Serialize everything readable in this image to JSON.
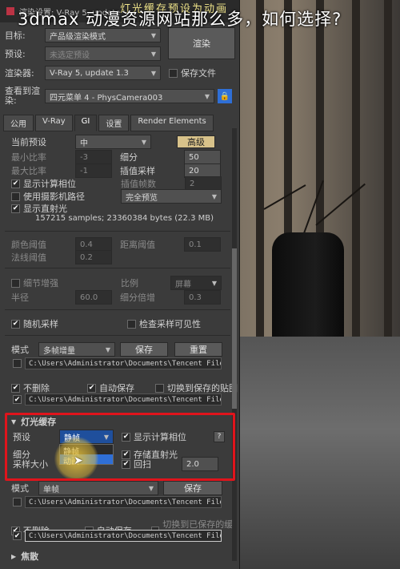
{
  "overlay_title": "3dmax 动漫资源网站那么多，如何选择?",
  "banner_text": "灯光缓存预设为动画",
  "titlebar": {
    "text": "渲染设置: V-Ray 5, update"
  },
  "top": {
    "target_label": "目标:",
    "target_value": "产品级渲染模式",
    "preset_label": "预设:",
    "preset_value": "未选定预设",
    "renderer_label": "渲染器:",
    "renderer_value": "V-Ray 5, update 1.3",
    "save_file_label": "保存文件",
    "render_button": "渲染",
    "view_label": "查看到渲染:",
    "view_value": "四元菜单 4 - PhysCamera003"
  },
  "tabs": [
    "公用",
    "V-Ray",
    "GI",
    "设置",
    "Render Elements"
  ],
  "gi": {
    "current_preset_label": "当前预设",
    "current_preset_value": "中",
    "advanced_button": "高级",
    "min_rate_label": "最小比率",
    "min_rate_value": "-3",
    "max_rate_label": "最大比率",
    "max_rate_value": "-1",
    "subdivs_label": "细分",
    "subdivs_value": "50",
    "interp_samples_label": "插值采样",
    "interp_samples_value": "20",
    "interp_frames_label": "插值帧数",
    "interp_frames_value": "2",
    "show_calc_phase": "显示计算相位",
    "use_camera_path": "使用摄影机路径",
    "show_direct_light": "显示直射光",
    "full_preview": "完全预览",
    "samples_info": "157215 samples; 23360384 bytes (22.3 MB)",
    "color_thresh_label": "颜色阈值",
    "color_thresh_value": "0.4",
    "dist_thresh_label": "距离阈值",
    "dist_thresh_value": "0.1",
    "normal_thresh_label": "法线阈值",
    "normal_thresh_value": "0.2",
    "detail_enh": "细节增强",
    "scale_label": "比例",
    "scale_value": "屏幕",
    "radius_label": "半径",
    "radius_value": "60.0",
    "subdiv_mult_label": "细分倍增",
    "subdiv_mult_value": "0.3",
    "random_samples": "随机采样",
    "check_visibility": "检查采样可见性",
    "mode_label": "模式",
    "mode_value": "多帧增量",
    "save_button": "保存",
    "reset_button": "重置",
    "path1": "C:\\Users\\Administrator\\Documents\\Tencent Files\\",
    "no_delete": "不删除",
    "auto_save": "自动保存",
    "switch_saved": "切换到保存的贴图",
    "path2": "C:\\Users\\Administrator\\Documents\\Tencent Files\\"
  },
  "light_cache": {
    "header": "灯光缓存",
    "preset_label": "预设",
    "preset_value": "静帧",
    "subdivs_label": "细分",
    "dropdown_opt1": "静帧",
    "dropdown_opt2": "动画",
    "sample_size_label": "采样大小",
    "show_calc_phase": "显示计算相位",
    "store_direct": "存储直射光",
    "retrace": "回扫",
    "retrace_value": "2.0",
    "help": "?",
    "mode_label": "模式",
    "mode_value": "单帧",
    "save_button": "保存",
    "path1": "C:\\Users\\Administrator\\Documents\\Tencent Files\\",
    "no_delete": "不删除",
    "auto_save": "自动保存",
    "switch_saved": "切换到已保存的缓存",
    "path2": "C:\\Users\\Administrator\\Documents\\Tencent Files\\"
  },
  "caustics_header": "焦散",
  "colors": {
    "accent_red": "#e0141c",
    "highlight": "#f0c83c",
    "selected_blue": "#2f6fd6"
  }
}
